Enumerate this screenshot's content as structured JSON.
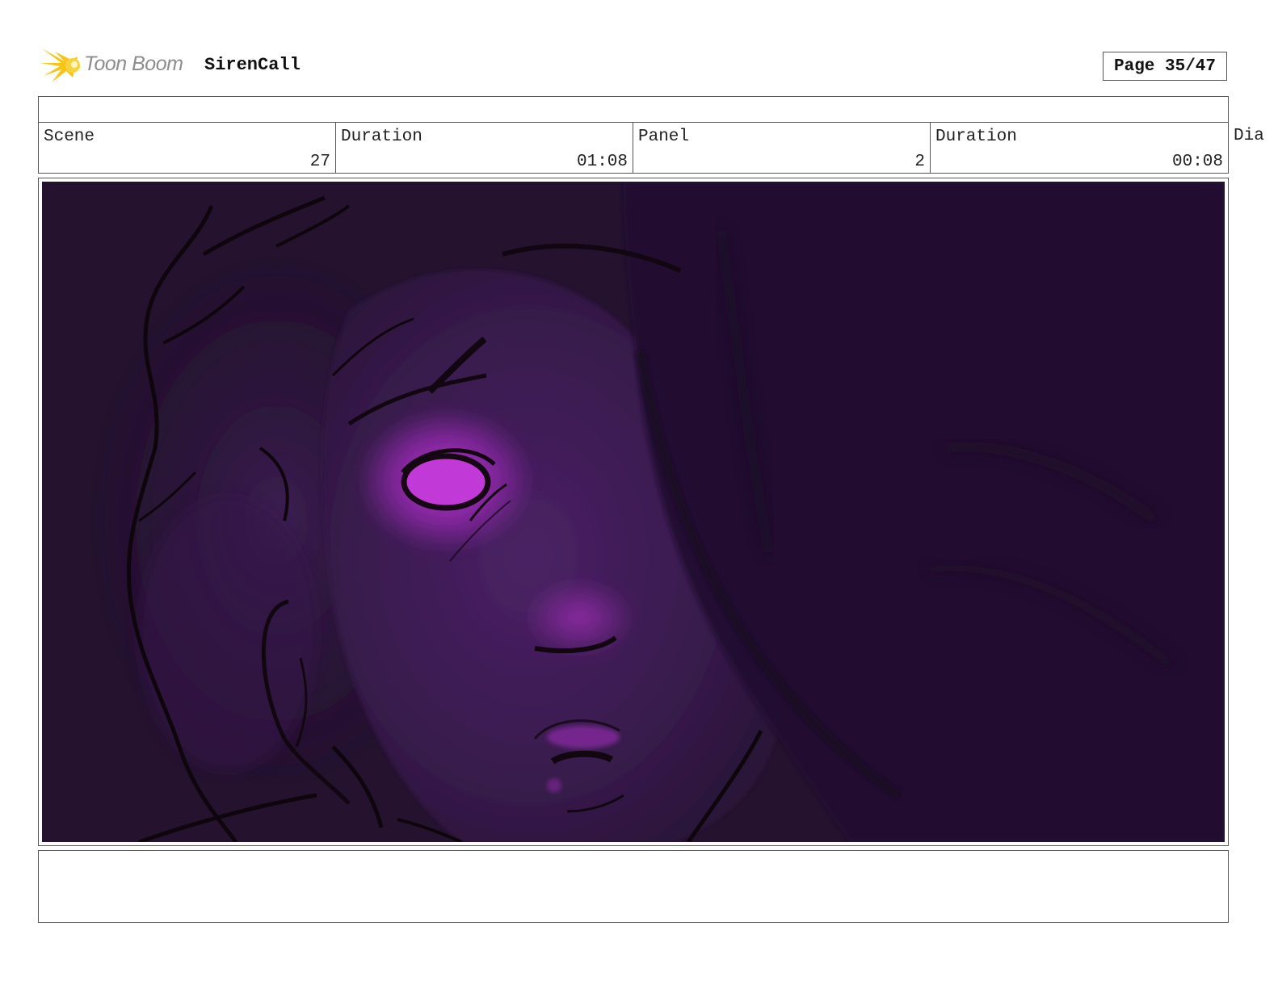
{
  "header": {
    "logo_text": "Toon Boom",
    "project_title": "SirenCall",
    "page_label": "Page 35/47"
  },
  "info": {
    "scene_label": "Scene",
    "scene_value": "27",
    "scene_duration_label": "Duration",
    "scene_duration_value": "01:08",
    "panel_label": "Panel",
    "panel_value": "2",
    "panel_duration_label": "Duration",
    "panel_duration_value": "00:08",
    "dialog_label_partial": "Dia"
  },
  "colors": {
    "panel_background": "#24122f",
    "face_purple": "#3a1c4f",
    "glow_magenta": "#b52ad0",
    "logo_yellow": "#f5c518",
    "logo_gray": "#8c8c8c"
  }
}
